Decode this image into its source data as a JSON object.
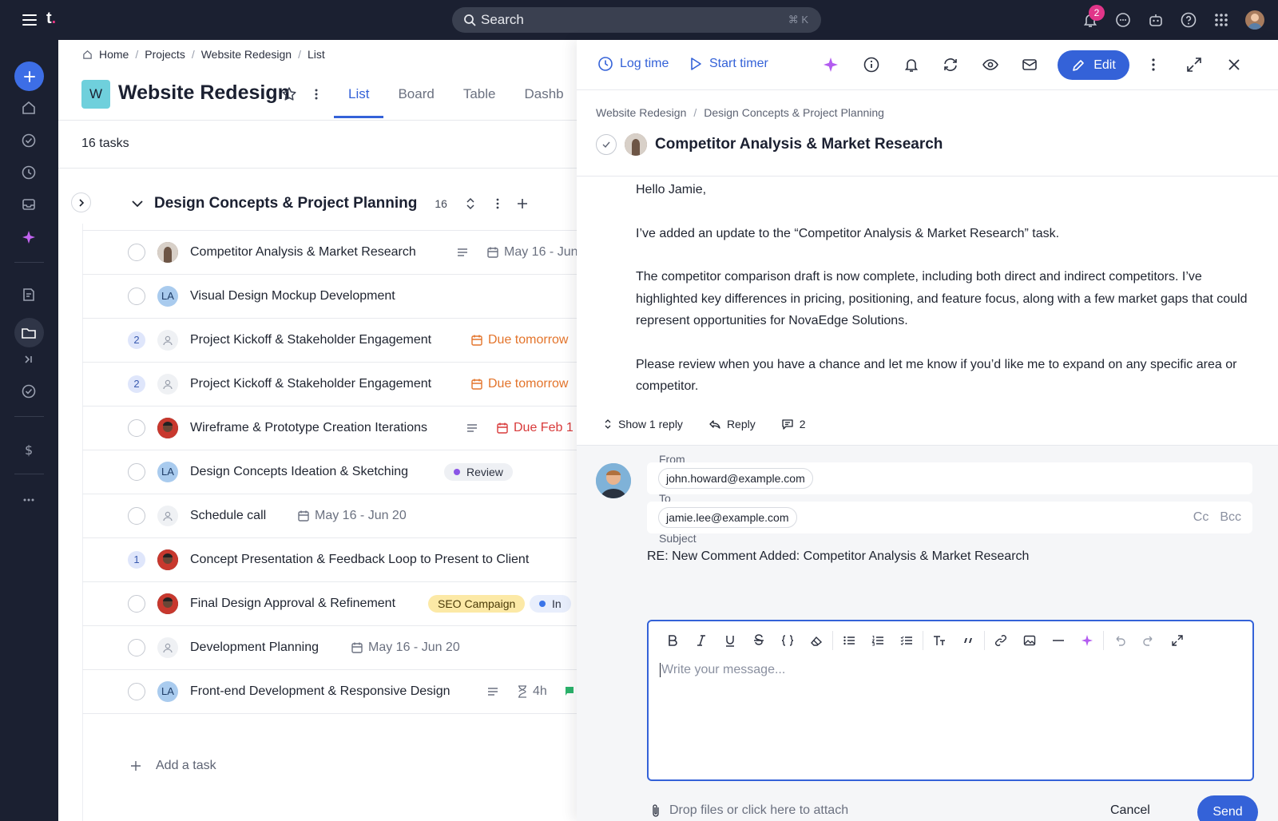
{
  "app": {
    "logo": "t",
    "logo_dot": "."
  },
  "search": {
    "placeholder": "Search",
    "shortcut": "⌘ K"
  },
  "topbar": {
    "notifications_count": "2"
  },
  "breadcrumb": [
    "Home",
    "Projects",
    "Website Redesign",
    "List"
  ],
  "project": {
    "badge": "W",
    "title": "Website Redesign"
  },
  "tabs": [
    "List",
    "Board",
    "Table",
    "Dashb"
  ],
  "task_count": "16 tasks",
  "group": {
    "title": "Design Concepts & Project Planning",
    "count": "16"
  },
  "tasks": [
    {
      "name": "Competitor Analysis & Market Research",
      "meta": "May 16 - Jun"
    },
    {
      "name": "Visual Design Mockup Development",
      "avatar": "LA"
    },
    {
      "name": "Project Kickoff & Stakeholder Engagement",
      "sub": "2",
      "meta": "Due tomorrow"
    },
    {
      "name": "Project Kickoff & Stakeholder Engagement",
      "sub": "2",
      "meta": "Due tomorrow"
    },
    {
      "name": "Wireframe & Prototype Creation Iterations",
      "meta": "Due Feb 1"
    },
    {
      "name": "Design Concepts Ideation & Sketching",
      "avatar": "LA",
      "pill": "Review"
    },
    {
      "name": "Schedule call",
      "meta": "May 16 - Jun 20"
    },
    {
      "name": "Concept Presentation & Feedback Loop to Present to Client",
      "sub": "1"
    },
    {
      "name": "Final Design Approval & Refinement",
      "pill": "SEO Campaign",
      "pill2": "In"
    },
    {
      "name": "Development Planning",
      "meta": "May 16 - Jun 20"
    },
    {
      "name": "Front-end Development & Responsive Design",
      "avatar": "LA",
      "meta": "4h"
    }
  ],
  "add_task": "Add a task",
  "panel": {
    "log_time": "Log time",
    "start_timer": "Start timer",
    "edit": "Edit",
    "crumb": [
      "Website Redesign",
      "Design Concepts & Project Planning"
    ],
    "title": "Competitor Analysis & Market Research",
    "message": [
      "Hello Jamie,",
      "I’ve added an update to the “Competitor Analysis & Market Research” task.",
      "The competitor comparison draft is now complete, including both direct and indirect competitors. I’ve highlighted key differences in pricing, positioning, and feature focus, along with a few market gaps that could represent opportunities for NovaEdge Solutions.",
      "Please review when you have a chance and let me know if you’d like me to expand on any specific area or competitor."
    ],
    "show_reply": "Show 1 reply",
    "reply": "Reply",
    "comment_count": "2"
  },
  "compose": {
    "from_label": "From",
    "from": "john.howard@example.com",
    "to_label": "To",
    "to": "jamie.lee@example.com",
    "cc": "Cc",
    "bcc": "Bcc",
    "subject_label": "Subject",
    "subject": "RE: New Comment Added: Competitor Analysis & Market Research",
    "placeholder": "Write your message...",
    "attach": "Drop files or click here to attach",
    "cancel": "Cancel",
    "send": "Send"
  },
  "colors": {
    "accent": "#3462d8",
    "nav_bg": "#1b2031",
    "badge_pink": "#e13589"
  }
}
